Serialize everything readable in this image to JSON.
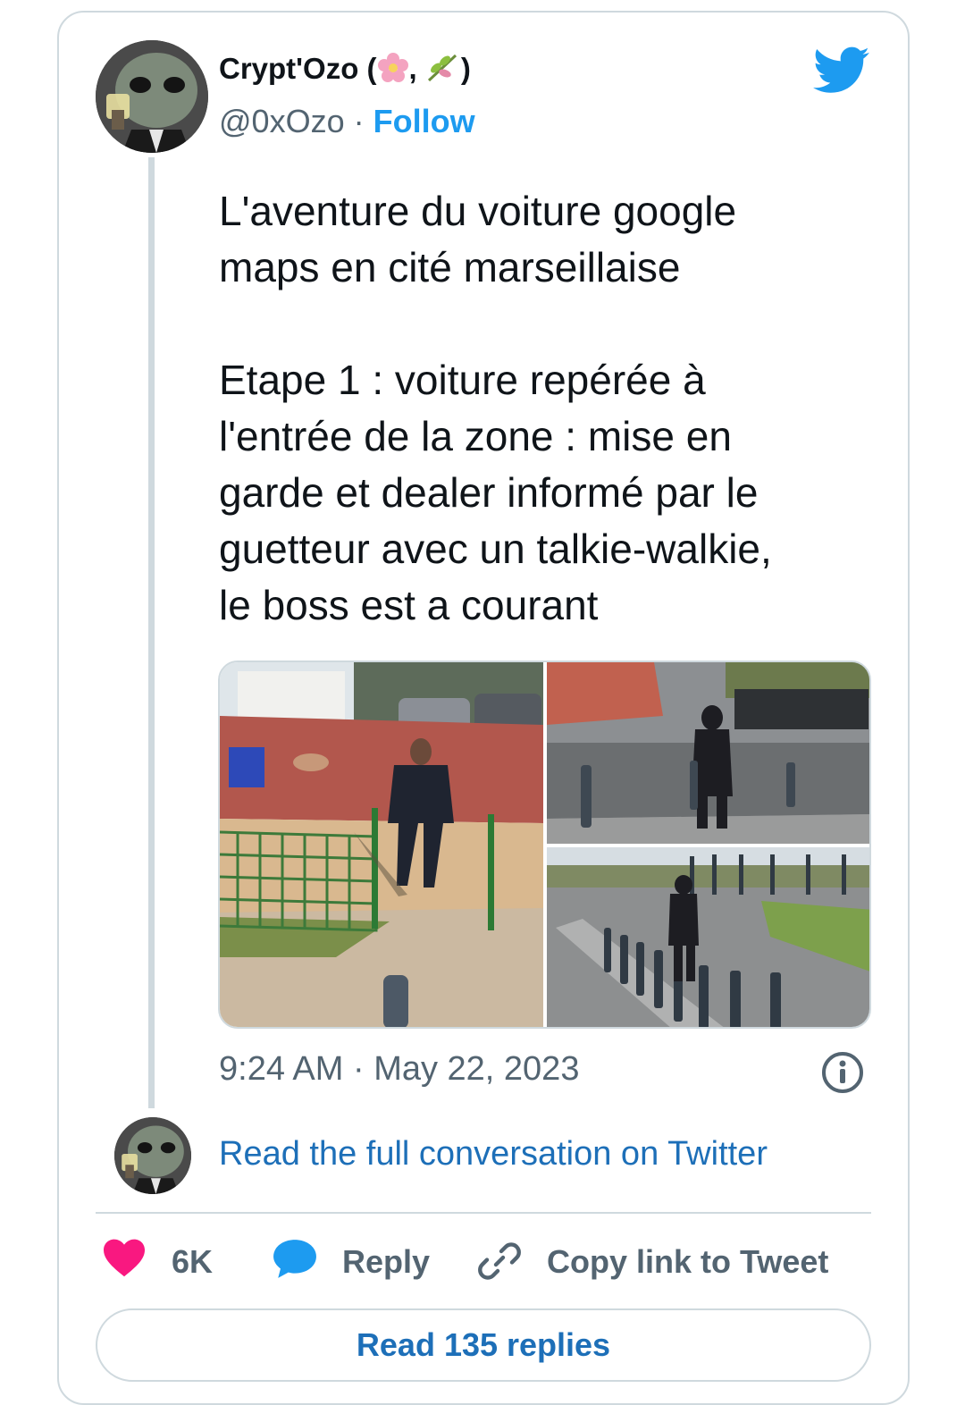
{
  "author": {
    "name": "Crypt'Ozo (",
    "name_sep": ",",
    "name_close": ")",
    "name_emojis": [
      "cherry-blossom",
      "herb"
    ],
    "handle": "@0xOzo",
    "dot": "·",
    "follow_label": "Follow"
  },
  "tweet": {
    "text": "L'aventure du voiture google\nmaps en cité marseillaise\n\nEtape 1 : voiture repérée à\nl'entrée de la zone : mise en\ngarde et dealer informé par le\nguetteur avec un talkie-walkie,\nle boss est a courant",
    "timestamp": "9:24 AM · May 22, 2023",
    "images": [
      "street-view-playground",
      "street-view-bins",
      "street-view-bollards"
    ]
  },
  "read_conversation": "Read the full conversation on Twitter",
  "actions": {
    "likes": "6K",
    "reply": "Reply",
    "copy_link": "Copy link to Tweet"
  },
  "read_replies": "Read 135 replies",
  "colors": {
    "twitter_blue": "#1d9bf0",
    "link_blue": "#1d6fb8",
    "heart": "#f91880",
    "muted": "#536471",
    "border": "#cfd9de"
  }
}
